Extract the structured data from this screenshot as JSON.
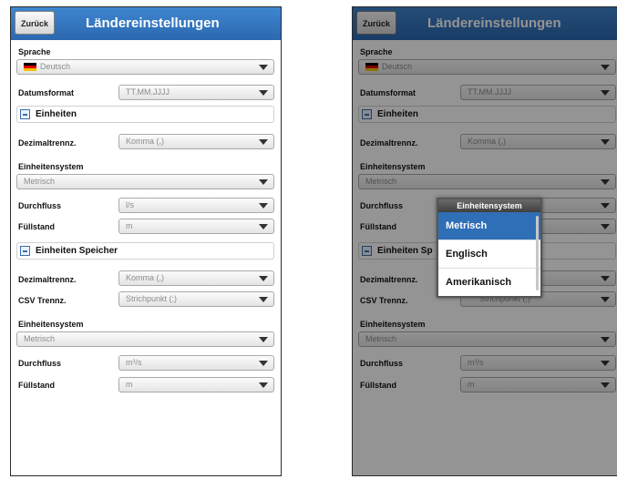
{
  "header": {
    "back_label": "Zurück",
    "title": "Ländereinstellungen"
  },
  "sprache": {
    "label": "Sprache",
    "value": "Deutsch"
  },
  "datumsformat": {
    "label": "Datumsformat",
    "value": "TT.MM.JJJJ"
  },
  "einheiten": {
    "title": "Einheiten",
    "dezimal_label": "Dezimaltrennz.",
    "dezimal_value": "Komma (,)",
    "system_label": "Einheitensystem",
    "system_value": "Metrisch",
    "durchfluss_label": "Durchfluss",
    "durchfluss_value": "l/s",
    "fuellstand_label": "Füllstand",
    "fuellstand_value": "m"
  },
  "speicher": {
    "title": "Einheiten Speicher",
    "title_truncated": "Einheiten Sp",
    "dezimal_label": "Dezimaltrennz.",
    "dezimal_value": "Komma (,)",
    "csv_label": "CSV Trennz.",
    "csv_value": "Strichpunkt (;)",
    "system_label": "Einheitensystem",
    "system_value": "Metrisch",
    "durchfluss_label": "Durchfluss",
    "durchfluss_value": "m³/s",
    "fuellstand_label": "Füllstand",
    "fuellstand_value": "m"
  },
  "popup": {
    "title": "Einheitensystem",
    "options": [
      "Metrisch",
      "Englisch",
      "Amerikanisch"
    ],
    "selected": "Metrisch"
  },
  "colors": {
    "accent": "#2f6fb7",
    "titlebar": "#3a7ac4"
  }
}
